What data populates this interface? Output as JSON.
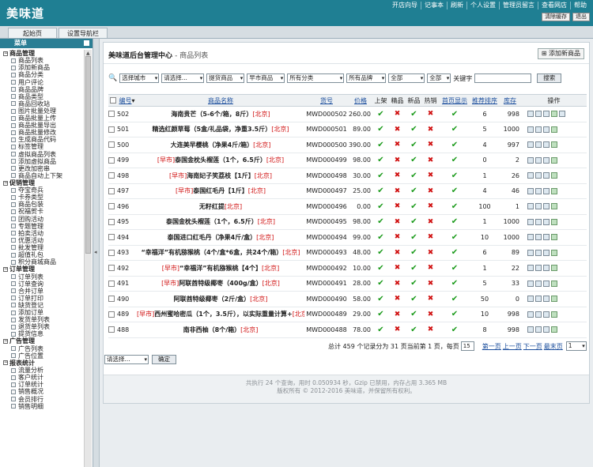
{
  "brand": {
    "logo": "美味道"
  },
  "topnav": [
    "开店向导",
    "记事本",
    "刷新",
    "个人设置",
    "管理员留言",
    "查看网店",
    "帮助"
  ],
  "topbtns": [
    "清除缓存",
    "退出"
  ],
  "tabs": [
    "起始页",
    "设置导航栏"
  ],
  "sidebar": {
    "title": "菜单",
    "groups": [
      {
        "label": "商品管理",
        "items": [
          "商品列表",
          "添加新商品",
          "商品分类",
          "用户评论",
          "商品品牌",
          "商品类型",
          "商品回收站",
          "图片批量处理",
          "商品批量上传",
          "商品批量导出",
          "商品批量修改",
          "生成商品代码",
          "标签管理",
          "虚拟商品列表",
          "添加虚拟商品",
          "更改加密串",
          "商品自动上下架"
        ]
      },
      {
        "label": "促销管理",
        "items": [
          "夺宝奇兵",
          "卡券类型",
          "商品包装",
          "祝福贺卡",
          "团购活动",
          "专题管理",
          "拍卖活动",
          "优惠活动",
          "批发管理",
          "超值礼包",
          "积分商城商品"
        ]
      },
      {
        "label": "订单管理",
        "items": [
          "订单列表",
          "订单查询",
          "合并订单",
          "订单打印",
          "缺货登记",
          "添加订单",
          "发货单列表",
          "退货单列表",
          "提货信息"
        ]
      },
      {
        "label": "广告管理",
        "items": [
          "广告列表",
          "广告位置"
        ]
      },
      {
        "label": "报表统计",
        "items": [
          "流量分析",
          "客户统计",
          "订单统计",
          "销售概况",
          "会员排行",
          "销售明细"
        ]
      }
    ]
  },
  "main": {
    "title": "美味道后台管理中心",
    "subtitle": "- 商品列表",
    "add_button": "添加新商品"
  },
  "filters": {
    "selects": [
      "选择城市",
      "请选择...",
      "提货商品",
      "早市商品",
      "所有分类",
      "所有品牌",
      "全部",
      "全部"
    ],
    "keyword_label": "关键字",
    "search_button": "搜索"
  },
  "table": {
    "headers": [
      "编号",
      "商品名称",
      "货号",
      "价格",
      "上架",
      "精品",
      "新品",
      "热销",
      "首页显示",
      "推荐排序",
      "库存",
      "操作"
    ],
    "rows": [
      {
        "id": "502",
        "prefix": "",
        "name": "海南贵芒（5-6个/箱，8斤）",
        "region": "[北京]",
        "sku": "MWD000502",
        "price": "260.00",
        "flags": [
          1,
          0,
          1,
          0,
          1
        ],
        "sort": "6",
        "stock": "998",
        "ops": 5
      },
      {
        "id": "501",
        "prefix": "",
        "name": "精选红颜草莓（5盒/礼品袋，净重3.5斤）",
        "region": "[北京]",
        "sku": "MWD000501",
        "price": "89.00",
        "flags": [
          1,
          0,
          1,
          0,
          1
        ],
        "sort": "5",
        "stock": "1000",
        "ops": 4
      },
      {
        "id": "500",
        "prefix": "",
        "name": "大连美早樱桃（净果4斤/箱）",
        "region": "[北京]",
        "sku": "MWD000500",
        "price": "390.00",
        "flags": [
          1,
          0,
          1,
          0,
          1
        ],
        "sort": "4",
        "stock": "997",
        "ops": 4
      },
      {
        "id": "499",
        "prefix": "[早市]",
        "name": "泰国金枕头榴莲（1个，6.5斤）",
        "region": "[北京]",
        "sku": "MWD000499",
        "price": "98.00",
        "flags": [
          1,
          0,
          1,
          0,
          1
        ],
        "sort": "0",
        "stock": "2",
        "ops": 4
      },
      {
        "id": "498",
        "prefix": "[早市]",
        "name": "海南妃子笑荔枝【1斤】",
        "region": "[北京]",
        "sku": "MWD000498",
        "price": "30.00",
        "flags": [
          1,
          0,
          1,
          0,
          1
        ],
        "sort": "1",
        "stock": "26",
        "ops": 4
      },
      {
        "id": "497",
        "prefix": "[早市]",
        "name": "泰国红毛丹【1斤】",
        "region": "[北京]",
        "sku": "MWD000497",
        "price": "25.00",
        "flags": [
          1,
          0,
          1,
          0,
          1
        ],
        "sort": "4",
        "stock": "46",
        "ops": 4
      },
      {
        "id": "496",
        "prefix": "",
        "name": "无籽红提",
        "region": "[北京]",
        "sku": "MWD000496",
        "price": "0.00",
        "flags": [
          1,
          0,
          1,
          0,
          1
        ],
        "sort": "100",
        "stock": "1",
        "ops": 4
      },
      {
        "id": "495",
        "prefix": "",
        "name": "泰国金枕头榴莲（1个，6.5斤）",
        "region": "[北京]",
        "sku": "MWD000495",
        "price": "98.00",
        "flags": [
          1,
          0,
          1,
          0,
          1
        ],
        "sort": "1",
        "stock": "1000",
        "ops": 4
      },
      {
        "id": "494",
        "prefix": "",
        "name": "泰国进口红毛丹（净果4斤/盒）",
        "region": "[北京]",
        "sku": "MWD000494",
        "price": "99.00",
        "flags": [
          1,
          0,
          1,
          0,
          1
        ],
        "sort": "10",
        "stock": "1000",
        "ops": 4
      },
      {
        "id": "493",
        "prefix": "",
        "name": "“幸福洋”有机猕猴桃（4个/盒*6盒，共24个/箱）",
        "region": "[北京]",
        "sku": "MWD000493",
        "price": "48.00",
        "flags": [
          1,
          0,
          1,
          0,
          1
        ],
        "sort": "6",
        "stock": "89",
        "ops": 4
      },
      {
        "id": "492",
        "prefix": "[早市]",
        "name": "“幸福洋”有机猕猴桃【4个】",
        "region": "[北京]",
        "sku": "MWD000492",
        "price": "10.00",
        "flags": [
          1,
          0,
          1,
          0,
          1
        ],
        "sort": "1",
        "stock": "22",
        "ops": 4
      },
      {
        "id": "491",
        "prefix": "[早市]",
        "name": "阿联酋特级椰枣（400g/盒）",
        "region": "[北京]",
        "sku": "MWD000491",
        "price": "28.00",
        "flags": [
          1,
          0,
          1,
          0,
          1
        ],
        "sort": "5",
        "stock": "33",
        "ops": 4
      },
      {
        "id": "490",
        "prefix": "",
        "name": "阿联酋特级椰枣（2斤/盒）",
        "region": "[北京]",
        "sku": "MWD000490",
        "price": "58.00",
        "flags": [
          1,
          0,
          1,
          0,
          1
        ],
        "sort": "50",
        "stock": "0",
        "ops": 4
      },
      {
        "id": "489",
        "prefix": "[早市]",
        "name": "西州蜜哈密瓜（1个，3.5斤），以实际重量计算+",
        "region": "[北京]",
        "sku": "MWD000489",
        "price": "29.00",
        "flags": [
          1,
          0,
          1,
          0,
          1
        ],
        "sort": "10",
        "stock": "998",
        "ops": 4
      },
      {
        "id": "488",
        "prefix": "",
        "name": "南非西柚（8个/箱）",
        "region": "[北京]",
        "sku": "MWD000488",
        "price": "78.00",
        "flags": [
          1,
          0,
          1,
          0,
          1
        ],
        "sort": "8",
        "stock": "998",
        "ops": 4
      }
    ]
  },
  "pager": {
    "summary": "总计 459 个记录分为 31 页当前第 1 页，每页",
    "page_size": "15",
    "first": "第一页",
    "prev": "上一页",
    "next": "下一页",
    "last": "最末页",
    "current": "1"
  },
  "bulk": {
    "select": "请选择...",
    "confirm": "确定"
  },
  "footer": {
    "line1": "共执行 24 个查询，用时 0.050934 秒，Gzip 已禁用，内存占用 3.365 MB",
    "line2": "版权所有 © 2012-2016 美味道，并保留所有权利。"
  }
}
